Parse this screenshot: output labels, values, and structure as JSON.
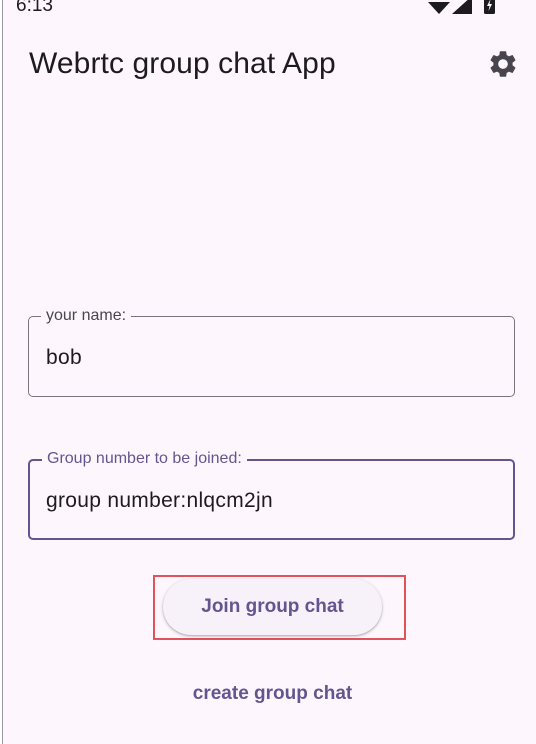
{
  "status_bar": {
    "time": "6:13"
  },
  "app_bar": {
    "title": "Webrtc group chat App",
    "settings_icon": "gear-icon"
  },
  "form": {
    "name_field": {
      "label": "your name:",
      "value": "bob"
    },
    "group_field": {
      "label": "Group number to be joined:",
      "value": "group number:nlqcm2jn"
    },
    "join_button": "Join group chat",
    "create_button": "create group chat"
  },
  "colors": {
    "background": "#fdf7fd",
    "primary": "#65558f",
    "outline": "#79757f",
    "highlight": "#e0525e"
  }
}
